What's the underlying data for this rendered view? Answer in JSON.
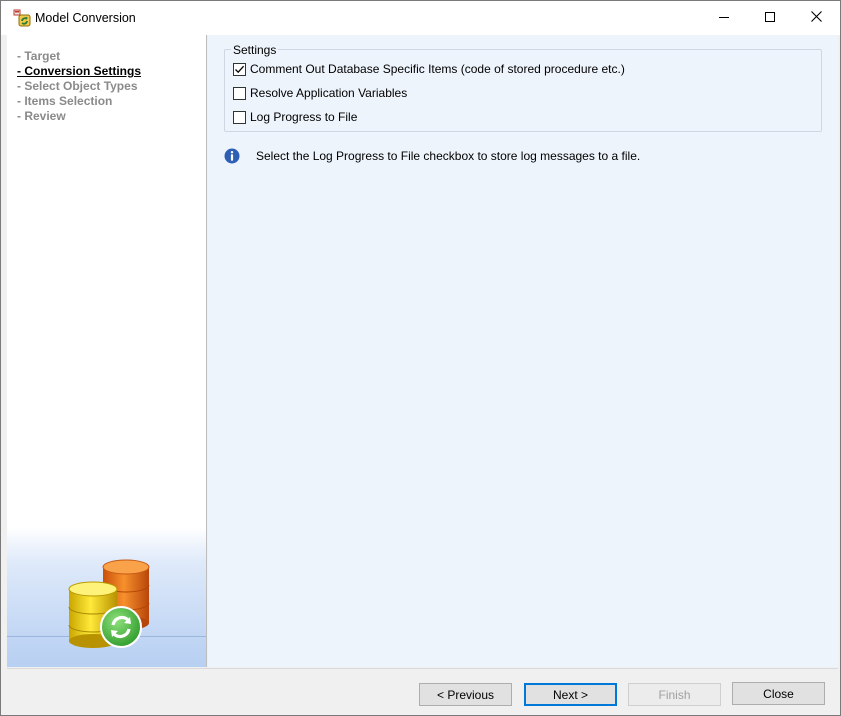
{
  "window": {
    "title": "Model Conversion"
  },
  "nav": {
    "items": [
      {
        "label": "- Target",
        "current": false
      },
      {
        "label": "- Conversion Settings",
        "current": true
      },
      {
        "label": "- Select Object Types",
        "current": false
      },
      {
        "label": "- Items Selection",
        "current": false
      },
      {
        "label": "- Review",
        "current": false
      }
    ]
  },
  "settings": {
    "legend": "Settings",
    "options": [
      {
        "label": "Comment Out Database Specific Items (code of stored procedure etc.)",
        "checked": true
      },
      {
        "label": "Resolve Application Variables",
        "checked": false
      },
      {
        "label": "Log Progress to File",
        "checked": false
      }
    ]
  },
  "info": {
    "text": "Select the Log Progress to File checkbox to store log messages to a file."
  },
  "buttons": {
    "previous": "< Previous",
    "next": "Next >",
    "finish": "Finish",
    "close": "Close"
  },
  "colors": {
    "content_bg": "#eef4fc",
    "accent": "#0078d7",
    "info_icon": "#2d5fb4"
  },
  "icons": {
    "app": "model-conversion-icon",
    "minimize": "minimize-icon",
    "maximize": "maximize-icon",
    "close": "close-icon",
    "info": "info-icon",
    "art": "database-refresh-icon"
  }
}
